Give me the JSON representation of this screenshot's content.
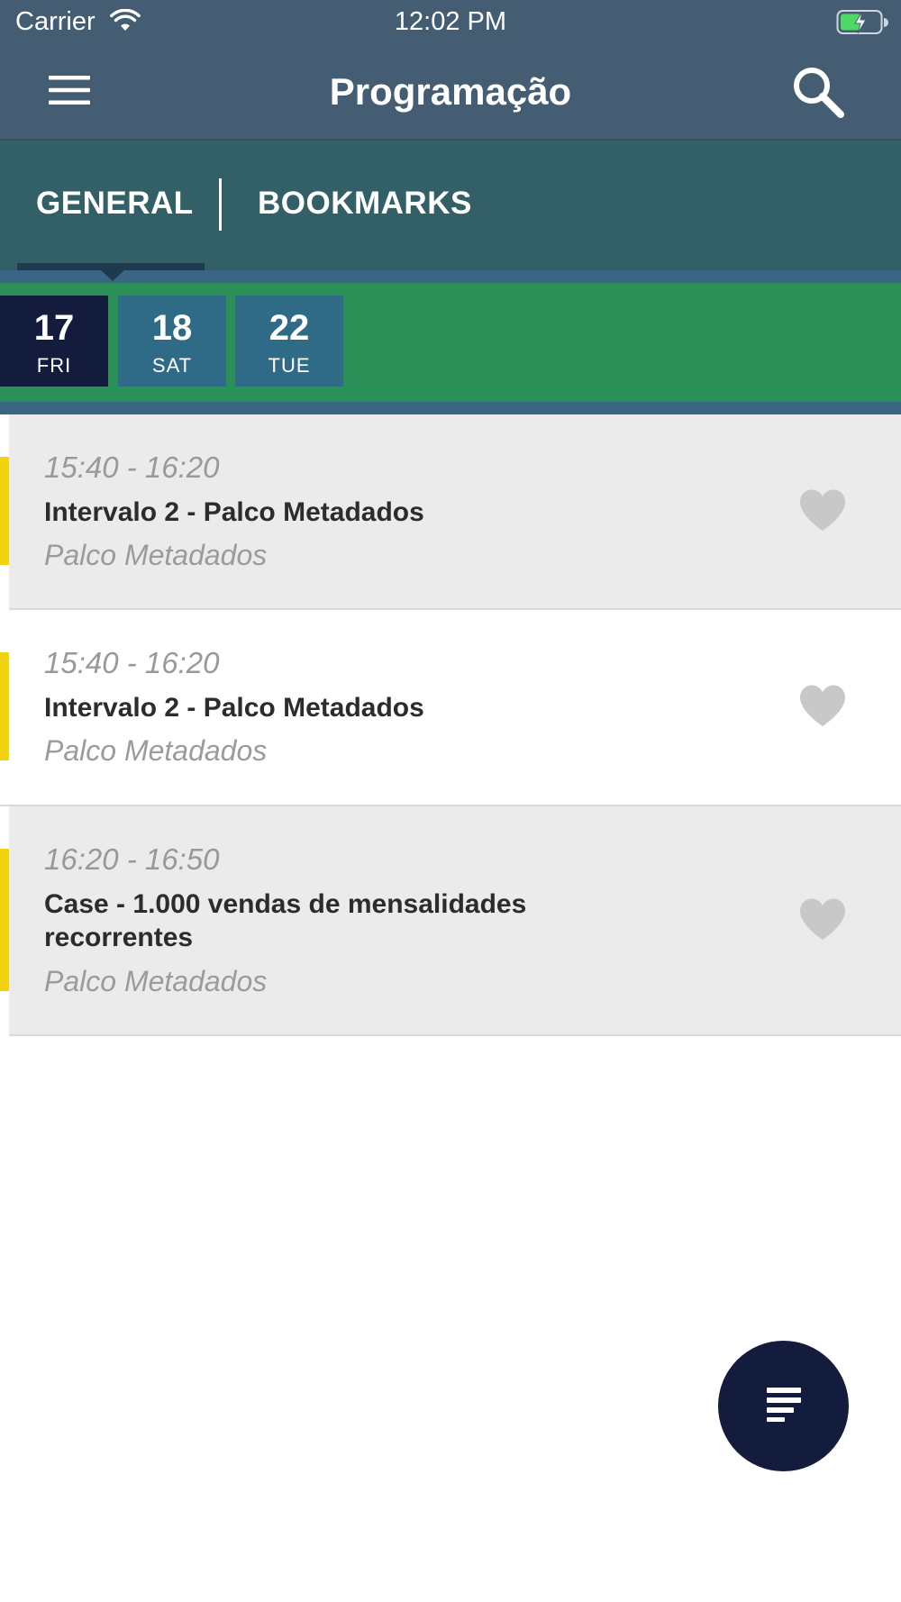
{
  "status_bar": {
    "carrier": "Carrier",
    "time": "12:02 PM",
    "icons": [
      "wifi-icon",
      "battery-charging-icon"
    ]
  },
  "nav": {
    "title": "Programação",
    "left_icon": "hamburger-menu-icon",
    "right_icon": "search-icon"
  },
  "tabs": {
    "items": [
      {
        "label": "GENERAL",
        "selected": true
      },
      {
        "label": "BOOKMARKS",
        "selected": false
      }
    ]
  },
  "dates": [
    {
      "day_number": "17",
      "weekday": "FRI",
      "selected": true
    },
    {
      "day_number": "18",
      "weekday": "SAT",
      "selected": false
    },
    {
      "day_number": "22",
      "weekday": "TUE",
      "selected": false
    }
  ],
  "sessions": [
    {
      "time": "15:40 - 16:20",
      "title": "Intervalo 2 - Palco Metadados",
      "venue": "Palco Metadados",
      "bookmarked": false
    },
    {
      "time": "15:40 - 16:20",
      "title": "Intervalo 2 - Palco Metadados",
      "venue": "Palco Metadados",
      "bookmarked": false
    },
    {
      "time": "16:20 - 16:50",
      "title": "Case - 1.000 vendas de mensalidades recorrentes",
      "venue": "Palco Metadados",
      "bookmarked": false
    }
  ],
  "fab": {
    "icon": "filter-lines-icon"
  },
  "colors": {
    "header": "#445d72",
    "tabs": "#335f66",
    "date_bar": "#2b8f58",
    "date_selected": "#131c3c",
    "date_unselected": "#2f6b86",
    "accent_track": "#f2d30f",
    "fab": "#131c3c",
    "heart": "#c8c8c8"
  }
}
